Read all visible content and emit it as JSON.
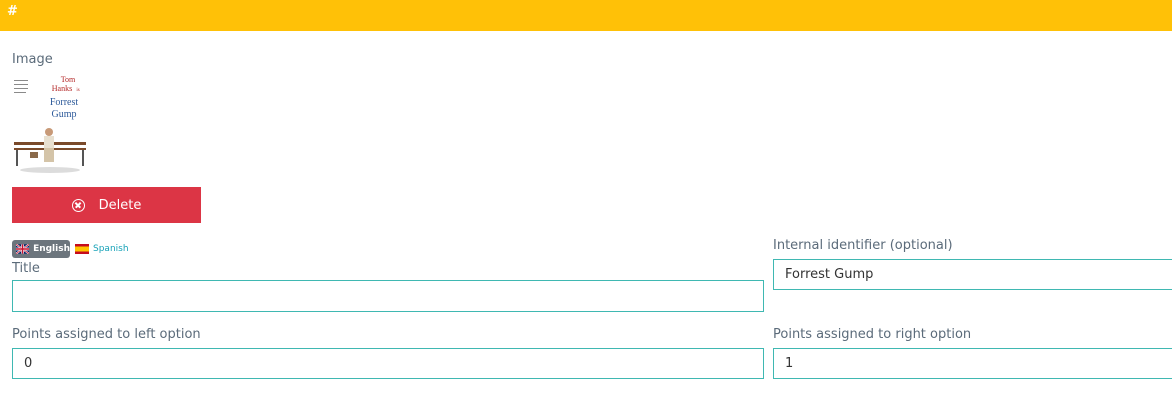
{
  "header": {
    "hash": "#"
  },
  "image_section": {
    "label": "Image"
  },
  "poster": {
    "line1": "Tom",
    "line2": "Hanks",
    "line2_suffix": "is",
    "line3": "Forrest",
    "line4": "Gump"
  },
  "delete_button": {
    "label": "Delete"
  },
  "languages": {
    "active": "English",
    "inactive": "Spanish"
  },
  "title_field": {
    "label": "Title",
    "value": ""
  },
  "internal_id_field": {
    "label": "Internal identifier (optional)",
    "value": "Forrest Gump"
  },
  "left_points_field": {
    "label": "Points assigned to left option",
    "value": "0"
  },
  "right_points_field": {
    "label": "Points assigned to right option",
    "value": "1"
  },
  "colors": {
    "topbar": "#ffc107",
    "delete": "#dc3545",
    "input_border": "#3fb8b2",
    "label": "#5b6b7a"
  }
}
